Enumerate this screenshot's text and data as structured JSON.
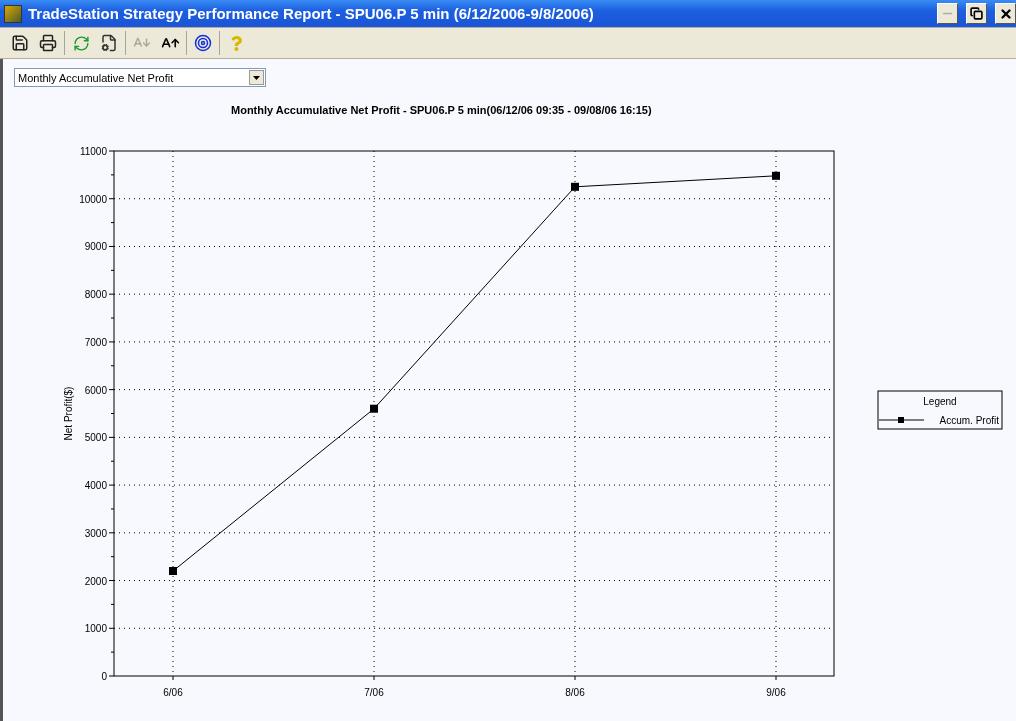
{
  "window": {
    "title": "TradeStation Strategy Performance Report - SPU06.P 5 min (6/12/2006-9/8/2006)",
    "controls": [
      {
        "kind": "minimize",
        "disabled": true
      },
      {
        "kind": "restore",
        "disabled": false
      },
      {
        "kind": "close",
        "disabled": false
      }
    ]
  },
  "toolbar": [
    [
      {
        "kind": "save",
        "disabled": false
      },
      {
        "kind": "print",
        "disabled": false
      }
    ],
    [
      {
        "kind": "refresh",
        "disabled": false
      },
      {
        "kind": "properties",
        "disabled": false
      }
    ],
    [
      {
        "kind": "font-smaller",
        "disabled": true
      },
      {
        "kind": "font-larger",
        "disabled": false
      }
    ],
    [
      {
        "kind": "target",
        "disabled": false
      }
    ],
    [
      {
        "kind": "help",
        "disabled": false
      }
    ]
  ],
  "report_select": {
    "value": "Monthly Accumulative Net Profit"
  },
  "chart": {
    "legend_title": "Legend",
    "chart_data": {
      "type": "line",
      "title": "Monthly Accumulative Net Profit - SPU06.P 5 min(06/12/06 09:35 - 09/08/06 16:15)",
      "ylabel": "Net Profit($)",
      "categories": [
        "6/06",
        "7/06",
        "8/06",
        "9/06"
      ],
      "grid": true,
      "series": [
        {
          "name": "Accum. Profit",
          "color": "#000000",
          "marker": "square",
          "values": [
            2200,
            5600,
            10250,
            10480
          ]
        }
      ],
      "ylim": [
        0,
        11000
      ],
      "yticks": [
        0,
        1000,
        2000,
        3000,
        4000,
        5000,
        6000,
        7000,
        8000,
        9000,
        10000,
        11000
      ]
    }
  }
}
